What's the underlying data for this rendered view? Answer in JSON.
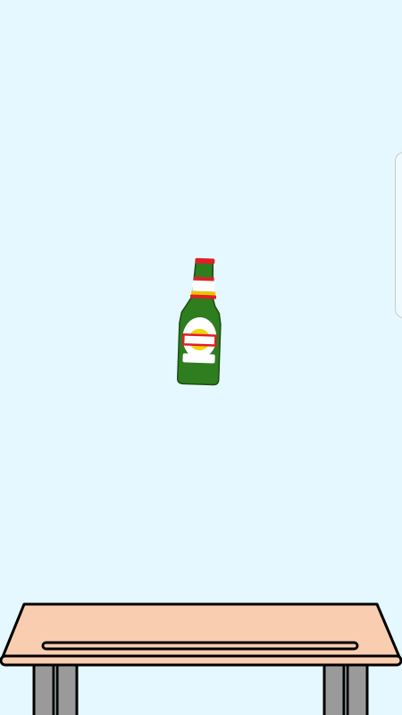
{
  "scene": {
    "background_color": "#e5f8ff",
    "bottle": {
      "type": "beer-bottle",
      "glass_color": "#2e7d1e",
      "label_color": "#ffffff",
      "emblem_color": "#f2d20b",
      "band_color": "#e01f26",
      "neck_stripe_colors": [
        "#e01f26",
        "#ffffff",
        "#f2c100"
      ]
    },
    "table": {
      "top_color": "#f9cdb0",
      "leg_color": "#9a9a9a",
      "outline_color": "#000000"
    },
    "edge_panel": {
      "icon": "edge-panel-handle"
    }
  }
}
